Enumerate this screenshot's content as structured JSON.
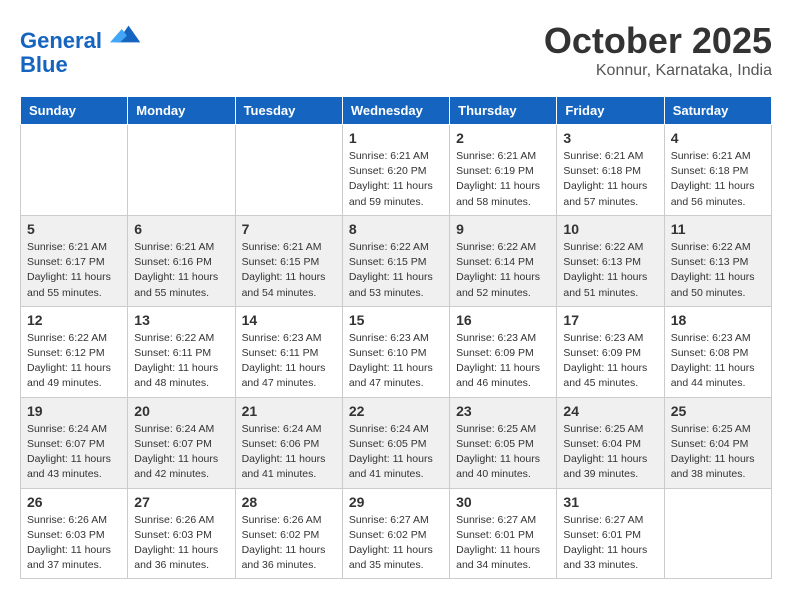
{
  "header": {
    "logo_line1": "General",
    "logo_line2": "Blue",
    "month_title": "October 2025",
    "location": "Konnur, Karnataka, India"
  },
  "weekdays": [
    "Sunday",
    "Monday",
    "Tuesday",
    "Wednesday",
    "Thursday",
    "Friday",
    "Saturday"
  ],
  "weeks": [
    [
      {
        "day": "",
        "info": ""
      },
      {
        "day": "",
        "info": ""
      },
      {
        "day": "",
        "info": ""
      },
      {
        "day": "1",
        "info": "Sunrise: 6:21 AM\nSunset: 6:20 PM\nDaylight: 11 hours\nand 59 minutes."
      },
      {
        "day": "2",
        "info": "Sunrise: 6:21 AM\nSunset: 6:19 PM\nDaylight: 11 hours\nand 58 minutes."
      },
      {
        "day": "3",
        "info": "Sunrise: 6:21 AM\nSunset: 6:18 PM\nDaylight: 11 hours\nand 57 minutes."
      },
      {
        "day": "4",
        "info": "Sunrise: 6:21 AM\nSunset: 6:18 PM\nDaylight: 11 hours\nand 56 minutes."
      }
    ],
    [
      {
        "day": "5",
        "info": "Sunrise: 6:21 AM\nSunset: 6:17 PM\nDaylight: 11 hours\nand 55 minutes."
      },
      {
        "day": "6",
        "info": "Sunrise: 6:21 AM\nSunset: 6:16 PM\nDaylight: 11 hours\nand 55 minutes."
      },
      {
        "day": "7",
        "info": "Sunrise: 6:21 AM\nSunset: 6:15 PM\nDaylight: 11 hours\nand 54 minutes."
      },
      {
        "day": "8",
        "info": "Sunrise: 6:22 AM\nSunset: 6:15 PM\nDaylight: 11 hours\nand 53 minutes."
      },
      {
        "day": "9",
        "info": "Sunrise: 6:22 AM\nSunset: 6:14 PM\nDaylight: 11 hours\nand 52 minutes."
      },
      {
        "day": "10",
        "info": "Sunrise: 6:22 AM\nSunset: 6:13 PM\nDaylight: 11 hours\nand 51 minutes."
      },
      {
        "day": "11",
        "info": "Sunrise: 6:22 AM\nSunset: 6:13 PM\nDaylight: 11 hours\nand 50 minutes."
      }
    ],
    [
      {
        "day": "12",
        "info": "Sunrise: 6:22 AM\nSunset: 6:12 PM\nDaylight: 11 hours\nand 49 minutes."
      },
      {
        "day": "13",
        "info": "Sunrise: 6:22 AM\nSunset: 6:11 PM\nDaylight: 11 hours\nand 48 minutes."
      },
      {
        "day": "14",
        "info": "Sunrise: 6:23 AM\nSunset: 6:11 PM\nDaylight: 11 hours\nand 47 minutes."
      },
      {
        "day": "15",
        "info": "Sunrise: 6:23 AM\nSunset: 6:10 PM\nDaylight: 11 hours\nand 47 minutes."
      },
      {
        "day": "16",
        "info": "Sunrise: 6:23 AM\nSunset: 6:09 PM\nDaylight: 11 hours\nand 46 minutes."
      },
      {
        "day": "17",
        "info": "Sunrise: 6:23 AM\nSunset: 6:09 PM\nDaylight: 11 hours\nand 45 minutes."
      },
      {
        "day": "18",
        "info": "Sunrise: 6:23 AM\nSunset: 6:08 PM\nDaylight: 11 hours\nand 44 minutes."
      }
    ],
    [
      {
        "day": "19",
        "info": "Sunrise: 6:24 AM\nSunset: 6:07 PM\nDaylight: 11 hours\nand 43 minutes."
      },
      {
        "day": "20",
        "info": "Sunrise: 6:24 AM\nSunset: 6:07 PM\nDaylight: 11 hours\nand 42 minutes."
      },
      {
        "day": "21",
        "info": "Sunrise: 6:24 AM\nSunset: 6:06 PM\nDaylight: 11 hours\nand 41 minutes."
      },
      {
        "day": "22",
        "info": "Sunrise: 6:24 AM\nSunset: 6:05 PM\nDaylight: 11 hours\nand 41 minutes."
      },
      {
        "day": "23",
        "info": "Sunrise: 6:25 AM\nSunset: 6:05 PM\nDaylight: 11 hours\nand 40 minutes."
      },
      {
        "day": "24",
        "info": "Sunrise: 6:25 AM\nSunset: 6:04 PM\nDaylight: 11 hours\nand 39 minutes."
      },
      {
        "day": "25",
        "info": "Sunrise: 6:25 AM\nSunset: 6:04 PM\nDaylight: 11 hours\nand 38 minutes."
      }
    ],
    [
      {
        "day": "26",
        "info": "Sunrise: 6:26 AM\nSunset: 6:03 PM\nDaylight: 11 hours\nand 37 minutes."
      },
      {
        "day": "27",
        "info": "Sunrise: 6:26 AM\nSunset: 6:03 PM\nDaylight: 11 hours\nand 36 minutes."
      },
      {
        "day": "28",
        "info": "Sunrise: 6:26 AM\nSunset: 6:02 PM\nDaylight: 11 hours\nand 36 minutes."
      },
      {
        "day": "29",
        "info": "Sunrise: 6:27 AM\nSunset: 6:02 PM\nDaylight: 11 hours\nand 35 minutes."
      },
      {
        "day": "30",
        "info": "Sunrise: 6:27 AM\nSunset: 6:01 PM\nDaylight: 11 hours\nand 34 minutes."
      },
      {
        "day": "31",
        "info": "Sunrise: 6:27 AM\nSunset: 6:01 PM\nDaylight: 11 hours\nand 33 minutes."
      },
      {
        "day": "",
        "info": ""
      }
    ]
  ]
}
